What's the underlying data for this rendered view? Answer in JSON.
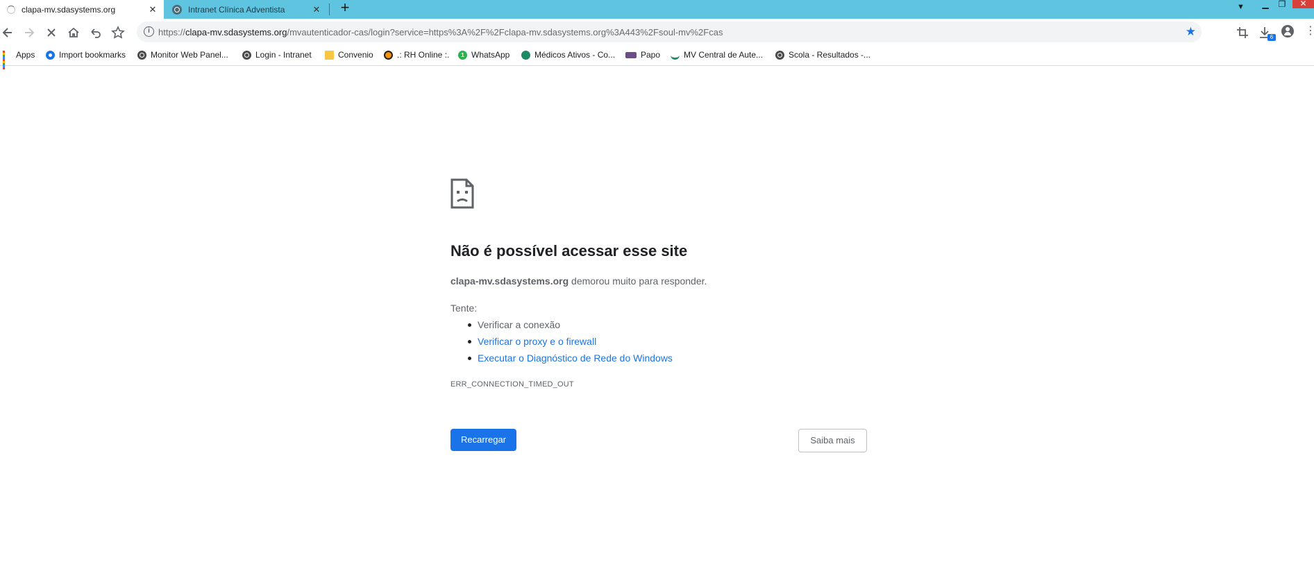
{
  "tabs": [
    {
      "title": "clapa-mv.sdasystems.org",
      "state": "loading"
    },
    {
      "title": "Intranet Clínica Adventista",
      "state": "inactive"
    }
  ],
  "new_tab_label": "+",
  "tab_close_glyph": "✕",
  "window_controls": {
    "minimize": "▁",
    "maximize": "❐",
    "close": "✕"
  },
  "omnibox": {
    "scheme": "https://",
    "host": "clapa-mv.sdasystems.org",
    "path": "/mvautenticador-cas/login?service=https%3A%2F%2Fclapa-mv.sdasystems.org%3A443%2Fsoul-mv%2Fcas",
    "bookmarked_star": "★"
  },
  "toolbar_icons": {
    "back": "back-arrow-icon",
    "forward": "forward-arrow-icon",
    "stop": "stop-icon",
    "home": "home-icon",
    "history": "undo-icon",
    "star": "star-icon",
    "crop": "crop-icon",
    "downloads": "download-icon",
    "profile": "profile-icon",
    "menu": "kebab-menu-icon"
  },
  "download_badge": "6",
  "bookmarks": [
    {
      "label": "Apps",
      "icon": "apps-grid-icon"
    },
    {
      "label": "Import bookmarks",
      "icon": "gear-icon"
    },
    {
      "label": "Monitor Web Panel...",
      "icon": "globe-icon"
    },
    {
      "label": "Login - Intranet",
      "icon": "globe-icon"
    },
    {
      "label": "Convenio",
      "icon": "folder-icon"
    },
    {
      "label": ".: RH Online :.",
      "icon": "rh-icon"
    },
    {
      "label": "WhatsApp",
      "icon": "whatsapp-icon"
    },
    {
      "label": "Médicos Ativos - Co...",
      "icon": "medicos-icon"
    },
    {
      "label": "Papo",
      "icon": "papo-icon"
    },
    {
      "label": "MV Central de Aute...",
      "icon": "mv-icon"
    },
    {
      "label": "Scola - Resultados -...",
      "icon": "globe-icon"
    }
  ],
  "error": {
    "title": "Não é possível acessar esse site",
    "host": "clapa-mv.sdasystems.org",
    "message": " demorou muito para responder.",
    "try_label": "Tente:",
    "suggestions": [
      {
        "label": "Verificar a conexão",
        "is_link": false
      },
      {
        "label": "Verificar o proxy e o firewall",
        "is_link": true
      },
      {
        "label": "Executar o Diagnóstico de Rede do Windows",
        "is_link": true
      }
    ],
    "code": "ERR_CONNECTION_TIMED_OUT",
    "reload_button": "Recarregar",
    "details_button": "Saiba mais"
  },
  "colors": {
    "tabstrip": "#5fc4e0",
    "accent": "#1a73e8",
    "close_button": "#d8403a"
  }
}
